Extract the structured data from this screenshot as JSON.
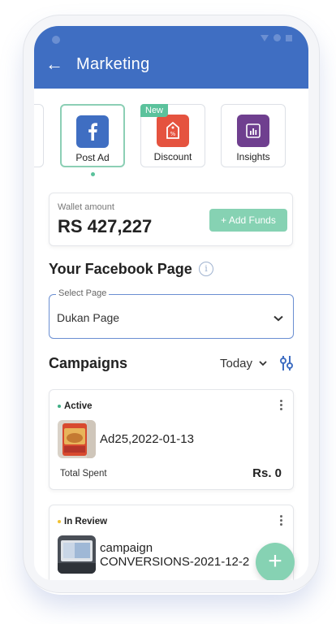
{
  "appbar": {
    "title": "Marketing"
  },
  "tiles": [
    {
      "label": "Post Ad",
      "icon": "facebook-icon",
      "color": "#3f6ec2"
    },
    {
      "label": "Discount",
      "icon": "discount-tag-icon",
      "color": "#e5533f",
      "badge": "New"
    },
    {
      "label": "Insights",
      "icon": "insights-chart-icon",
      "color": "#6f3f8f"
    }
  ],
  "wallet": {
    "label": "Wallet amount",
    "amount": "RS 427,227",
    "add_funds": "+ Add Funds"
  },
  "facebook_page": {
    "heading": "Your Facebook Page",
    "select_legend": "Select Page",
    "selected": "Dukan Page"
  },
  "campaigns": {
    "heading": "Campaigns",
    "filter": "Today",
    "items": [
      {
        "status": "Active",
        "status_color": "#3fae85",
        "name": "Ad25,2022-01-13",
        "spent_label": "Total Spent",
        "spent_value": "Rs. 0"
      },
      {
        "status": "In Review",
        "status_color": "#f1c232",
        "name_line1": "campaign",
        "name_line2": "CONVERSIONS-2021-12-2"
      }
    ]
  },
  "colors": {
    "primary": "#3f6ec2",
    "accent": "#86d2b3"
  }
}
